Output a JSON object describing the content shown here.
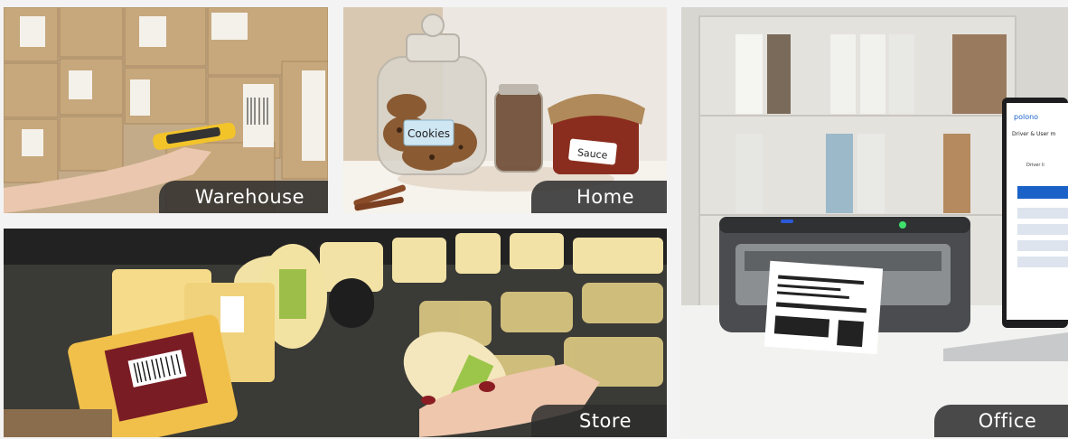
{
  "tiles": {
    "warehouse": {
      "caption": "Warehouse"
    },
    "home": {
      "caption": "Home",
      "jar_label": "Cookies",
      "sauce_label": "Sauce"
    },
    "store": {
      "caption": "Store"
    },
    "office": {
      "caption": "Office",
      "laptop_brand": "polono",
      "laptop_heading": "Driver & User m",
      "laptop_line": "Driver li"
    }
  },
  "colors": {
    "caption_bg": "#2d2d2d",
    "caption_text": "#ffffff",
    "page_bg": "#f3f3f3"
  }
}
